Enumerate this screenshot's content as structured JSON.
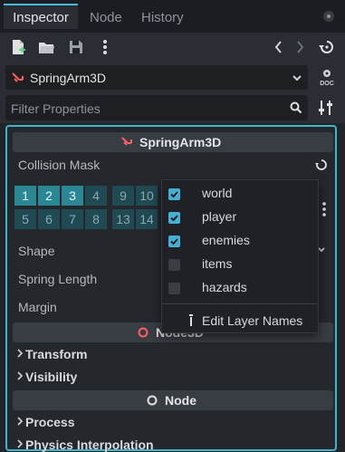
{
  "tabs": [
    {
      "label": "Inspector",
      "active": true
    },
    {
      "label": "Node",
      "active": false
    },
    {
      "label": "History",
      "active": false
    }
  ],
  "toolbar": {
    "icons": [
      "new-resource-icon",
      "open-folder-icon",
      "save-icon",
      "more-vertical-icon",
      "history-back-icon",
      "history-forward-icon",
      "object-history-icon"
    ]
  },
  "object": {
    "name": "SpringArm3D",
    "doc_label": "DOC"
  },
  "filter": {
    "placeholder": "Filter Properties"
  },
  "inspector": {
    "header": "SpringArm3D",
    "collision_mask_label": "Collision Mask",
    "layers_row1": [
      "1",
      "2",
      "3",
      "4",
      "9",
      "10"
    ],
    "layers_row2": [
      "5",
      "6",
      "7",
      "8",
      "13",
      "14"
    ],
    "layers_on": [
      "1",
      "2",
      "3"
    ],
    "shape_label": "Shape",
    "spring_length_label": "Spring Length",
    "margin_label": "Margin",
    "node3d_header": "Node3D",
    "transform_label": "Transform",
    "visibility_label": "Visibility",
    "node_header": "Node",
    "process_label": "Process",
    "physics_interp_label": "Physics Interpolation"
  },
  "popup": {
    "items": [
      {
        "label": "world",
        "checked": true
      },
      {
        "label": "player",
        "checked": true
      },
      {
        "label": "enemies",
        "checked": true
      },
      {
        "label": "items",
        "checked": false
      },
      {
        "label": "hazards",
        "checked": false
      }
    ],
    "edit_label": "Edit Layer Names"
  },
  "colors": {
    "accent": "#40b4c9",
    "node_icon_red": "#ff5f5f",
    "layer_on": "#2a8895",
    "layer_off": "#1f4953"
  }
}
